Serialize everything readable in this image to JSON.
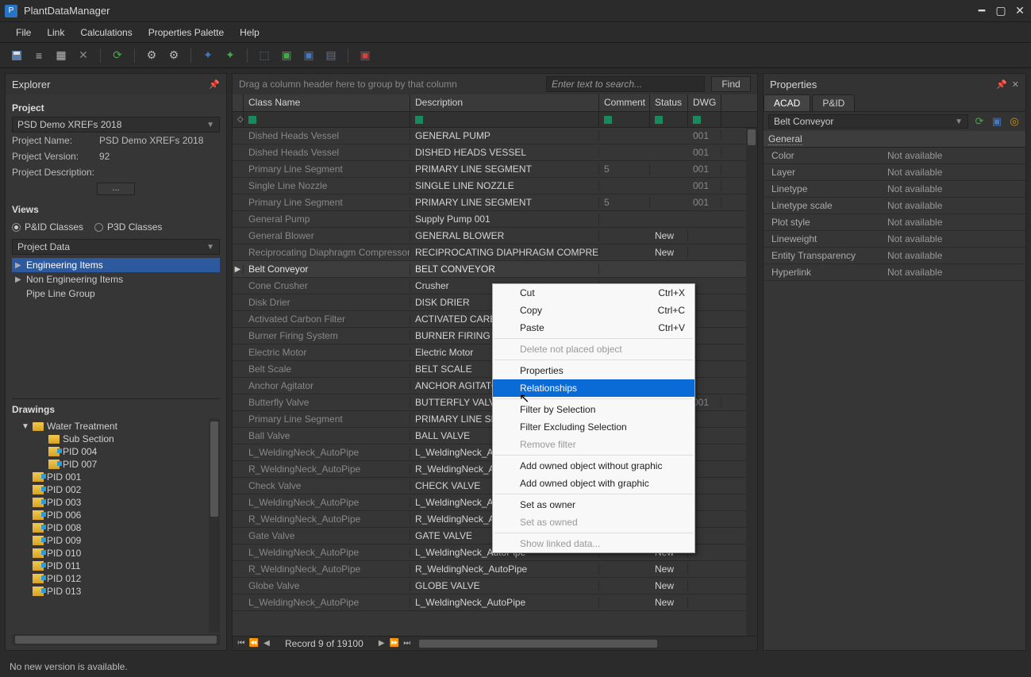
{
  "app": {
    "title": "PlantDataManager"
  },
  "menu": [
    "File",
    "Link",
    "Calculations",
    "Properties Palette",
    "Help"
  ],
  "explorer": {
    "title": "Explorer",
    "project_label": "Project",
    "project_combo": "PSD Demo XREFs 2018",
    "project_name_label": "Project Name:",
    "project_name": "PSD Demo XREFs 2018",
    "project_version_label": "Project Version:",
    "project_version": "92",
    "project_desc_label": "Project Description:",
    "views_label": "Views",
    "radio1": "P&ID Classes",
    "radio2": "P3D Classes",
    "data_combo": "Project Data",
    "tree": [
      {
        "label": "Engineering Items",
        "expandable": true
      },
      {
        "label": "Non Engineering Items",
        "expandable": true
      },
      {
        "label": "Pipe Line Group",
        "expandable": false
      }
    ],
    "drawings_label": "Drawings",
    "drawings": [
      {
        "label": "Water Treatment",
        "level": 0,
        "type": "folder",
        "open": true
      },
      {
        "label": "Sub Section",
        "level": 1,
        "type": "folder"
      },
      {
        "label": "PID 004",
        "level": 1,
        "type": "dwg"
      },
      {
        "label": "PID 007",
        "level": 1,
        "type": "dwg"
      },
      {
        "label": "PID 001",
        "level": 0,
        "type": "dwg"
      },
      {
        "label": "PID 002",
        "level": 0,
        "type": "dwg"
      },
      {
        "label": "PID 003",
        "level": 0,
        "type": "dwg"
      },
      {
        "label": "PID 006",
        "level": 0,
        "type": "dwg"
      },
      {
        "label": "PID 008",
        "level": 0,
        "type": "dwg"
      },
      {
        "label": "PID 009",
        "level": 0,
        "type": "dwg"
      },
      {
        "label": "PID 010",
        "level": 0,
        "type": "dwg"
      },
      {
        "label": "PID 011",
        "level": 0,
        "type": "dwg"
      },
      {
        "label": "PID 012",
        "level": 0,
        "type": "dwg"
      },
      {
        "label": "PID 013",
        "level": 0,
        "type": "dwg"
      }
    ]
  },
  "grid": {
    "group_hint": "Drag a column header here to group by that column",
    "search_placeholder": "Enter text to search...",
    "find_label": "Find",
    "columns": {
      "class": "Class Name",
      "desc": "Description",
      "comment": "Comment",
      "status": "Status",
      "dwg": "DWG ..."
    },
    "record_label": "Record 9 of 19100",
    "rows": [
      {
        "class": "Dished Heads Vessel",
        "desc": "GENERAL PUMP",
        "comment": "",
        "status": "",
        "dwg": "001"
      },
      {
        "class": "Dished Heads Vessel",
        "desc": "DISHED HEADS VESSEL",
        "comment": "",
        "status": "",
        "dwg": "001"
      },
      {
        "class": "Primary Line Segment",
        "desc": "PRIMARY LINE SEGMENT",
        "comment": "5",
        "status": "",
        "dwg": "001"
      },
      {
        "class": "Single Line Nozzle",
        "desc": "SINGLE LINE NOZZLE",
        "comment": "",
        "status": "",
        "dwg": "001"
      },
      {
        "class": "Primary Line Segment",
        "desc": "PRIMARY LINE SEGMENT",
        "comment": "5",
        "status": "",
        "dwg": "001"
      },
      {
        "class": "General Pump",
        "desc": "Supply Pump 001",
        "comment": "",
        "status": "",
        "dwg": ""
      },
      {
        "class": "General Blower",
        "desc": "GENERAL BLOWER",
        "comment": "",
        "status": "New",
        "dwg": ""
      },
      {
        "class": "Reciprocating Diaphragm Compressor",
        "desc": "RECIPROCATING DIAPHRAGM COMPRESSOR",
        "comment": "",
        "status": "New",
        "dwg": ""
      },
      {
        "class": "Belt Conveyor",
        "desc": "BELT CONVEYOR",
        "comment": "",
        "status": "",
        "dwg": "",
        "selected": true
      },
      {
        "class": "Cone Crusher",
        "desc": "Crusher",
        "comment": "",
        "status": "",
        "dwg": ""
      },
      {
        "class": "Disk Drier",
        "desc": "DISK DRIER",
        "comment": "",
        "status": "",
        "dwg": ""
      },
      {
        "class": "Activated Carbon Filter",
        "desc": "ACTIVATED CARBO",
        "comment": "",
        "status": "",
        "dwg": ""
      },
      {
        "class": "Burner Firing System",
        "desc": "BURNER FIRING SY",
        "comment": "",
        "status": "",
        "dwg": ""
      },
      {
        "class": "Electric Motor",
        "desc": "Electric Motor",
        "comment": "",
        "status": "",
        "dwg": ""
      },
      {
        "class": "Belt Scale",
        "desc": "BELT SCALE",
        "comment": "",
        "status": "",
        "dwg": ""
      },
      {
        "class": "Anchor Agitator",
        "desc": "ANCHOR AGITATOR",
        "comment": "",
        "status": "",
        "dwg": ""
      },
      {
        "class": "Butterfly Valve",
        "desc": "BUTTERFLY VALVE",
        "comment": "",
        "status": "",
        "dwg": "001"
      },
      {
        "class": "Primary Line Segment",
        "desc": "PRIMARY LINE SEG",
        "comment": "",
        "status": "",
        "dwg": ""
      },
      {
        "class": "Ball Valve",
        "desc": "BALL VALVE",
        "comment": "",
        "status": "",
        "dwg": ""
      },
      {
        "class": "L_WeldingNeck_AutoPipe",
        "desc": "L_WeldingNeck_Au",
        "comment": "",
        "status": "",
        "dwg": ""
      },
      {
        "class": "R_WeldingNeck_AutoPipe",
        "desc": "R_WeldingNeck_Au",
        "comment": "",
        "status": "",
        "dwg": ""
      },
      {
        "class": "Check Valve",
        "desc": "CHECK VALVE",
        "comment": "",
        "status": "",
        "dwg": ""
      },
      {
        "class": "L_WeldingNeck_AutoPipe",
        "desc": "L_WeldingNeck_Au",
        "comment": "",
        "status": "",
        "dwg": ""
      },
      {
        "class": "R_WeldingNeck_AutoPipe",
        "desc": "R_WeldingNeck_Au",
        "comment": "",
        "status": "",
        "dwg": ""
      },
      {
        "class": "Gate Valve",
        "desc": "GATE VALVE",
        "comment": "",
        "status": "",
        "dwg": ""
      },
      {
        "class": "L_WeldingNeck_AutoPipe",
        "desc": "L_WeldingNeck_AutoPipe",
        "comment": "",
        "status": "New",
        "dwg": ""
      },
      {
        "class": "R_WeldingNeck_AutoPipe",
        "desc": "R_WeldingNeck_AutoPipe",
        "comment": "",
        "status": "New",
        "dwg": ""
      },
      {
        "class": "Globe Valve",
        "desc": "GLOBE VALVE",
        "comment": "",
        "status": "New",
        "dwg": ""
      },
      {
        "class": "L_WeldingNeck_AutoPipe",
        "desc": "L_WeldingNeck_AutoPipe",
        "comment": "",
        "status": "New",
        "dwg": ""
      }
    ],
    "context_menu": [
      {
        "label": "Cut",
        "shortcut": "Ctrl+X"
      },
      {
        "label": "Copy",
        "shortcut": "Ctrl+C"
      },
      {
        "label": "Paste",
        "shortcut": "Ctrl+V"
      },
      {
        "sep": true
      },
      {
        "label": "Delete not placed object",
        "disabled": true
      },
      {
        "sep": true
      },
      {
        "label": "Properties"
      },
      {
        "label": "Relationships",
        "highlight": true
      },
      {
        "sep": true
      },
      {
        "label": "Filter by Selection"
      },
      {
        "label": "Filter Excluding Selection"
      },
      {
        "label": "Remove filter",
        "disabled": true
      },
      {
        "sep": true
      },
      {
        "label": "Add owned object without graphic"
      },
      {
        "label": "Add owned object with graphic"
      },
      {
        "sep": true
      },
      {
        "label": "Set as owner"
      },
      {
        "label": "Set as owned",
        "disabled": true
      },
      {
        "sep": true
      },
      {
        "label": "Show linked data...",
        "disabled": true
      }
    ]
  },
  "properties": {
    "title": "Properties",
    "tabs": {
      "acad": "ACAD",
      "pid": "P&ID"
    },
    "object": "Belt Conveyor",
    "category": "General",
    "rows": [
      {
        "k": "Color",
        "v": "Not available"
      },
      {
        "k": "Layer",
        "v": "Not available"
      },
      {
        "k": "Linetype",
        "v": "Not available"
      },
      {
        "k": "Linetype scale",
        "v": "Not available"
      },
      {
        "k": "Plot style",
        "v": "Not available"
      },
      {
        "k": "Lineweight",
        "v": "Not available"
      },
      {
        "k": "Entity Transparency",
        "v": "Not available"
      },
      {
        "k": "Hyperlink",
        "v": "Not available"
      }
    ]
  },
  "status": {
    "message": "No new version is available."
  }
}
